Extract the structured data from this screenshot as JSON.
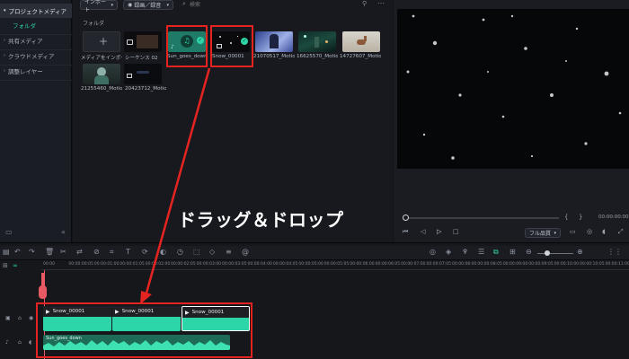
{
  "sidebar": {
    "items": [
      {
        "label": "プロジェクトメディア",
        "active": true
      },
      {
        "label": "フォルダ",
        "sub": true
      },
      {
        "label": "共有メディア"
      },
      {
        "label": "クラウドメディア"
      },
      {
        "label": "調整レイヤー"
      }
    ]
  },
  "media": {
    "import_label": "インポート",
    "sort_label": "録画／録音",
    "search_placeholder": "検索",
    "folder_label": "フォルダ",
    "items": [
      {
        "label": "メディアをインポート",
        "kind": "import"
      },
      {
        "label": "シーケンス 02",
        "kind": "sequence"
      },
      {
        "label": "Sun_goes_down",
        "kind": "audio"
      },
      {
        "label": "Snow_00001",
        "kind": "snow"
      },
      {
        "label": "21070517_Motio...",
        "kind": "blue"
      },
      {
        "label": "16625570_Motio...",
        "kind": "cyan"
      },
      {
        "label": "14727607_Motio...",
        "kind": "deer"
      },
      {
        "label": "21255460_Motio...",
        "kind": "person"
      },
      {
        "label": "20423712_Motio...",
        "kind": "dark"
      }
    ]
  },
  "annotation": {
    "drag_text": "ドラッグ＆ドロップ"
  },
  "preview": {
    "timecode": "00:00:00:00",
    "quality_label": "フル品質"
  },
  "timeline": {
    "ruler_labels": [
      "00:00",
      "00:00:00:05",
      "00:00:01:00",
      "00:00:01:05",
      "00:00:02:00",
      "00:00:02:05",
      "00:00:03:00",
      "00:00:03:05",
      "00:00:04:00",
      "00:00:04:05",
      "00:00:05:00",
      "00:00:05:05",
      "00:00:06:00",
      "00:00:06:05",
      "00:00:07:00",
      "00:00:07:05",
      "00:00:08:00",
      "00:00:08:05",
      "00:00:09:00",
      "00:00:09:05",
      "00:00:10:00",
      "00:00:10:05",
      "00:00:11:00"
    ],
    "video_clips": [
      "Snow_00001",
      "Snow_00001",
      "Snow_00001"
    ],
    "audio_clip": "Sun_goes_down"
  },
  "colors": {
    "accent": "#2dd6a8",
    "annotation_red": "#e52421"
  }
}
